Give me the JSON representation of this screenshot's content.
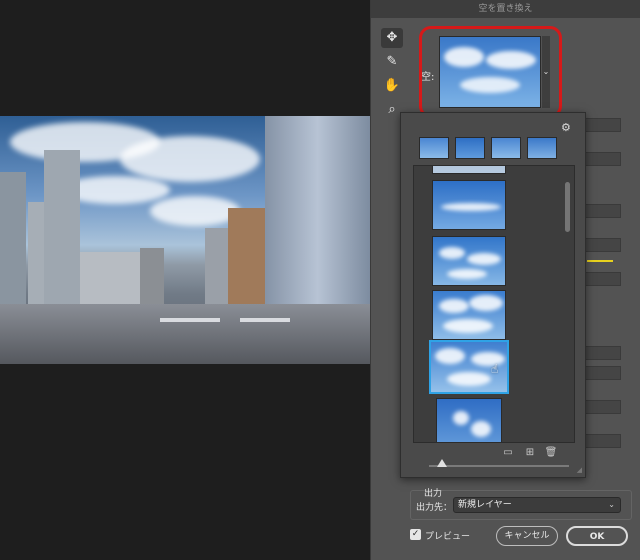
{
  "dialog": {
    "title": "空を置き換え"
  },
  "tools": [
    {
      "name": "move-tool",
      "glyph": "✥"
    },
    {
      "name": "sky-brush-tool",
      "glyph": "✎"
    },
    {
      "name": "hand-tool",
      "glyph": "✋"
    },
    {
      "name": "zoom-tool",
      "glyph": "⌕"
    }
  ],
  "sky": {
    "label": "空:",
    "dropdown_glyph": "⌄"
  },
  "popup": {
    "gear_glyph": "⚙",
    "buttons": {
      "folder": "▭",
      "add": "⊞",
      "trash": "🗑"
    }
  },
  "output": {
    "section_title": "出力",
    "destination_label": "出力先：",
    "destination_value": "新規レイヤー"
  },
  "preview": {
    "label": "プレビュー",
    "checked": true,
    "check_glyph": "✓"
  },
  "buttons": {
    "cancel": "キャンセル",
    "ok": "OK"
  },
  "colors": {
    "highlight": "#d61919",
    "selection": "#2fa3e6",
    "dialog_bg": "#535353"
  }
}
